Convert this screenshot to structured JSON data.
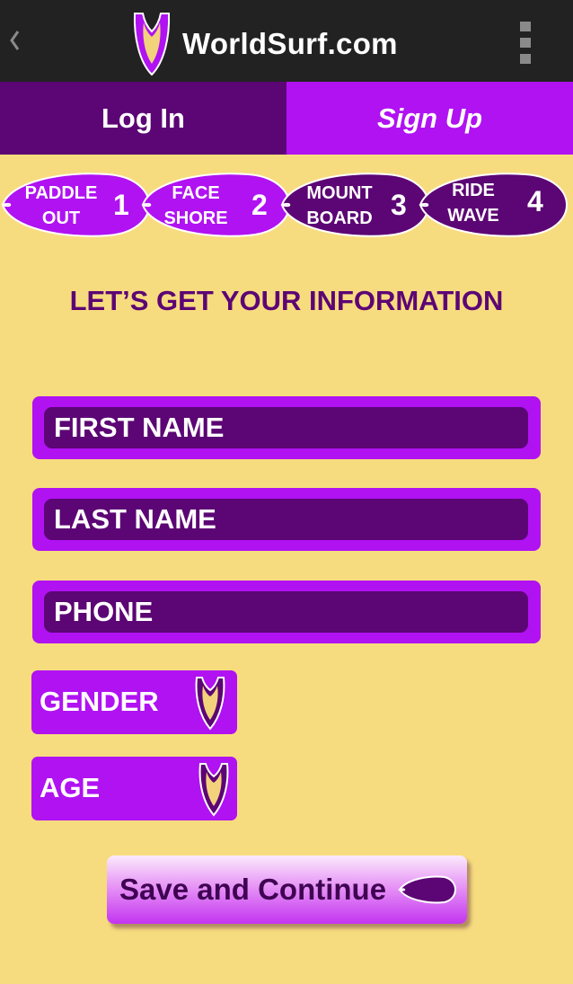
{
  "app": {
    "title": "WorldSurf.com",
    "back_icon": "chevron-left-icon",
    "menu_icon": "overflow-menu-icon",
    "logo_icon": "surfboard-logo-icon"
  },
  "tabs": [
    {
      "label": "Log In",
      "active": false
    },
    {
      "label": "Sign Up",
      "active": true
    }
  ],
  "steps": [
    {
      "label": "PADDLE\nOUT",
      "number": "1"
    },
    {
      "label": "FACE\nSHORE",
      "number": "2"
    },
    {
      "label": "MOUNT\nBOARD",
      "number": "3"
    },
    {
      "label": "RIDE\nWAVE",
      "number": "4"
    }
  ],
  "heading": "LET’S GET YOUR INFORMATION",
  "fields": {
    "first_name": {
      "placeholder": "FIRST NAME",
      "value": ""
    },
    "last_name": {
      "placeholder": "LAST NAME",
      "value": ""
    },
    "phone": {
      "placeholder": "PHONE",
      "value": ""
    }
  },
  "selects": {
    "gender": {
      "label": "GENDER",
      "icon": "surfboard-dropdown-icon"
    },
    "age": {
      "label": "AGE",
      "icon": "surfboard-dropdown-icon"
    }
  },
  "save_button": {
    "label": "Save and Continue",
    "icon": "surfboard-arrow-icon"
  },
  "colors": {
    "background": "#f7dc7f",
    "appbar": "#222222",
    "dark_purple": "#5c0574",
    "bright_purple": "#b012f2",
    "logo_yellow": "#f3d27c"
  }
}
